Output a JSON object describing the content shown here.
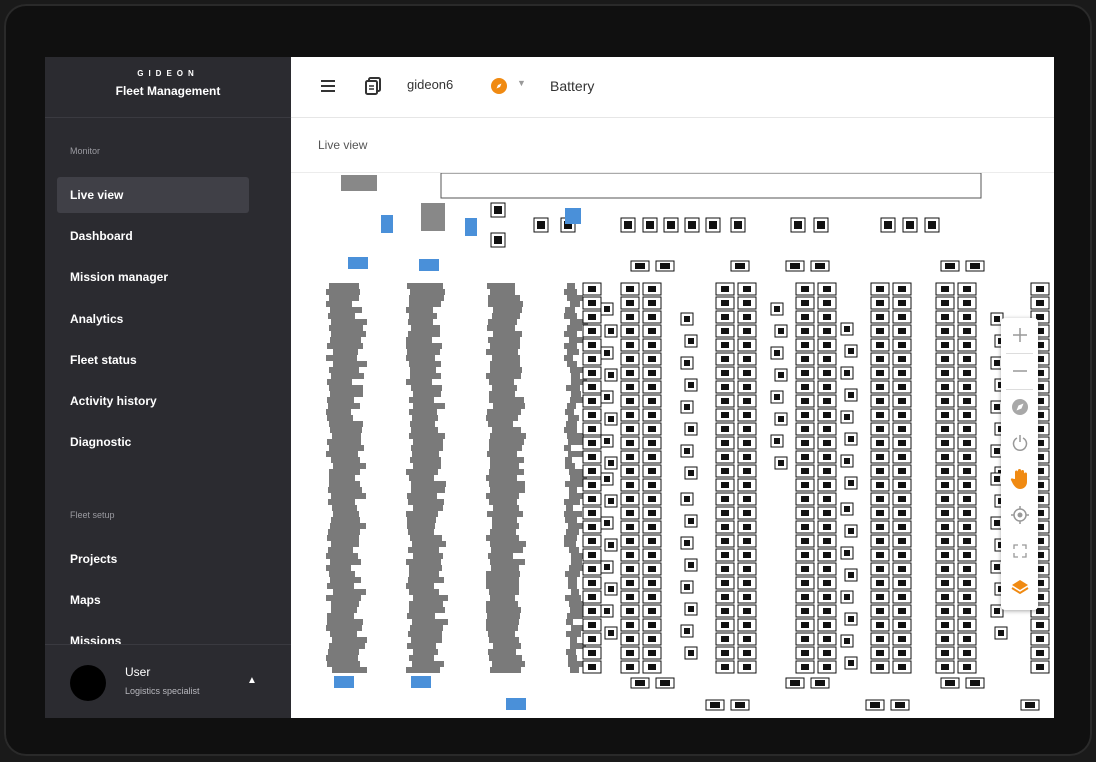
{
  "brand": {
    "logo_text": "GIDEON",
    "title": "Fleet Management"
  },
  "sidebar": {
    "monitor_label": "Monitor",
    "monitor_items": [
      {
        "label": "Live view",
        "active": true
      },
      {
        "label": "Dashboard"
      },
      {
        "label": "Mission manager"
      },
      {
        "label": "Analytics"
      },
      {
        "label": "Fleet status"
      },
      {
        "label": "Activity history"
      },
      {
        "label": "Diagnostic"
      }
    ],
    "setup_label": "Fleet setup",
    "setup_items": [
      {
        "label": "Projects"
      },
      {
        "label": "Maps"
      },
      {
        "label": "Missions"
      }
    ]
  },
  "user": {
    "name": "User",
    "role": "Logistics specialist"
  },
  "topbar": {
    "robot_name": "gideon6",
    "status_color": "#f08a12",
    "metric_label": "Battery"
  },
  "page": {
    "title": "Live view"
  },
  "map_tools": [
    {
      "icon": "zoom-in-icon"
    },
    {
      "icon": "zoom-out-icon"
    },
    {
      "icon": "compass-icon"
    },
    {
      "icon": "rotate-icon"
    },
    {
      "icon": "hand-pan-icon",
      "active": true
    },
    {
      "icon": "locate-icon"
    },
    {
      "icon": "fit-screen-icon"
    },
    {
      "icon": "layers-icon",
      "active": true
    }
  ],
  "colors": {
    "accent": "#f08a12",
    "sidebar": "#2b2b30",
    "marker": "#4a90d9"
  }
}
